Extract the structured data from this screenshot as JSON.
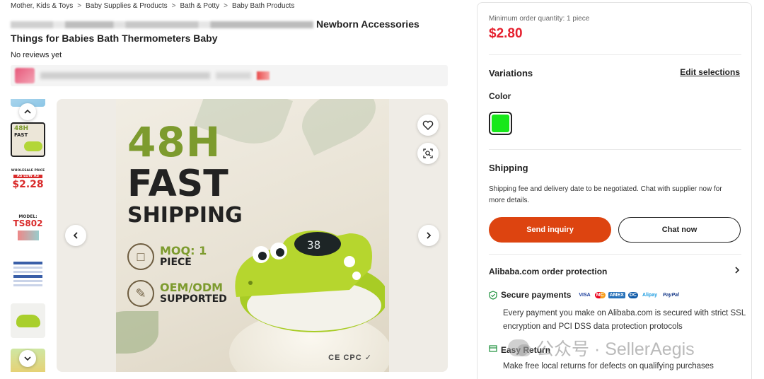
{
  "breadcrumb": [
    "Mother, Kids & Toys",
    "Baby Supplies & Products",
    "Bath & Potty",
    "Baby Bath Products"
  ],
  "breadcrumb_separator": ">",
  "product": {
    "title_visible_part_1": "Newborn Accessories",
    "title_line_2": "Things for Babies Bath Thermometers Baby",
    "reviews": "No reviews yet"
  },
  "thumbnails": [
    {
      "name": "thumb-partial-top"
    },
    {
      "name": "thumb-48h",
      "text_top": "48H",
      "text_bottom": "FAST"
    },
    {
      "name": "thumb-wholesale",
      "line1": "WHOLESALE PRICE",
      "line2": "AS LOW AS",
      "price": "$2.28"
    },
    {
      "name": "thumb-model",
      "line1": "MODEL:",
      "model": "TS802"
    },
    {
      "name": "thumb-spec-sheet"
    },
    {
      "name": "thumb-croc-product"
    },
    {
      "name": "thumb-partial-bottom"
    }
  ],
  "main_image": {
    "headline_1": "48H",
    "headline_2": "FAST",
    "headline_3": "SHIPPING",
    "feature_1_a": "MOQ: 1",
    "feature_1_b": "PIECE",
    "feature_2_a": "OEM/ODM",
    "feature_2_b": "SUPPORTED",
    "display_reading": "38",
    "certifications": "CE CPC ✓"
  },
  "icons": {
    "thumb_up": "chevron-up-icon",
    "thumb_down": "chevron-down-icon",
    "prev": "chevron-left-icon",
    "next": "chevron-right-icon",
    "favorite": "heart-icon",
    "visual_search": "image-search-icon"
  },
  "panel": {
    "moq": "Minimum order quantity: 1 piece",
    "price": "$2.80",
    "variations_title": "Variations",
    "edit_selections": "Edit selections",
    "color_label": "Color",
    "color_swatch": "#17e81a",
    "shipping_title": "Shipping",
    "shipping_text": "Shipping fee and delivery date to be negotiated. Chat with supplier now for more details.",
    "send_inquiry": "Send inquiry",
    "chat_now": "Chat now",
    "protection_title": "Alibaba.com order protection",
    "secure_payments": "Secure payments",
    "payment_logos": [
      "VISA",
      "MC",
      "AMEX",
      "DC",
      "Alipay",
      "PayPal"
    ],
    "secure_text": "Every payment you make on Alibaba.com is secured with strict SSL encryption and PCI DSS data protection protocols",
    "easy_return": "Easy Return",
    "easy_text": "Make free local returns for defects on qualifying purchases"
  },
  "colors": {
    "price_red": "#e5202e",
    "inquiry_orange": "#dd4410",
    "accent_green": "#7d9b2e"
  },
  "watermark": {
    "text": "公众号 · SellerAegis"
  }
}
